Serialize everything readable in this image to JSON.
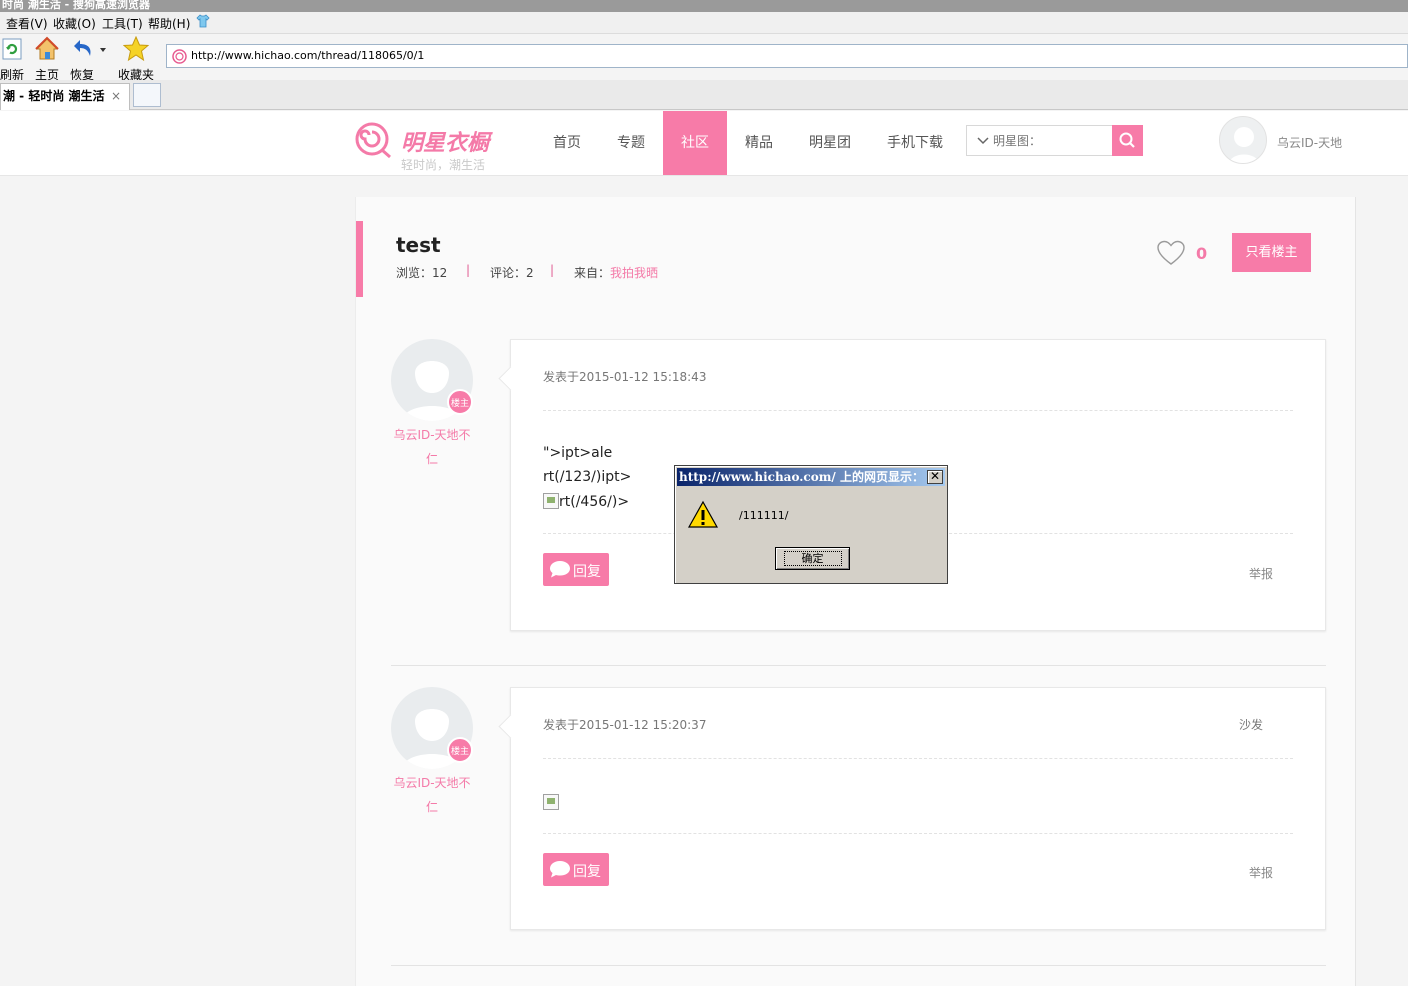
{
  "browser": {
    "window_title": "时尚 潮生活 - 搜狗高速浏览器",
    "menu": [
      "查看(V)",
      "收藏(O)",
      "工具(T)",
      "帮助(H)"
    ],
    "toolbar": {
      "refresh": "刷新",
      "home": "主页",
      "restore": "恢复",
      "favorites": "收藏夹"
    },
    "address": "http://www.hichao.com/thread/118065/0/1",
    "tab_title": "潮 - 轻时尚 潮生活",
    "tab_close": "×"
  },
  "site": {
    "logo_name": "明星衣橱",
    "logo_slogan": "轻时尚，潮生活",
    "nav": [
      "首页",
      "专题",
      "社区",
      "精品",
      "明星团",
      "手机下载"
    ],
    "search_placeholder": "明星图：",
    "user_name": "乌云ID-天地"
  },
  "thread": {
    "title": "test",
    "views_label": "浏览：",
    "views": "12",
    "comments_label": "评论：",
    "comments": "2",
    "source_label": "来自：",
    "source": "我拍我晒",
    "separator": "|",
    "likes": "0",
    "only_op_label": "只看楼主"
  },
  "posts": [
    {
      "badge": "楼主",
      "author_line1": "乌云ID-天地不",
      "author_line2": "仁",
      "time": "发表于2015-01-12 15:18:43",
      "floor": "",
      "body_line1": "\">ipt>ale",
      "body_line2": "rt(/123/)ipt>",
      "body_line3": "rt(/456/)>",
      "reply_label": "回复",
      "report_label": "举报"
    },
    {
      "badge": "楼主",
      "author_line1": "乌云ID-天地不",
      "author_line2": "仁",
      "time": "发表于2015-01-12 15:20:37",
      "floor": "沙发",
      "reply_label": "回复",
      "report_label": "举报"
    }
  ],
  "dialog": {
    "title": "http://www.hichao.com/ 上的网页显示：",
    "close": "✕",
    "message": "/111111/",
    "ok_label": "确定"
  },
  "colors": {
    "accent": "#f77ba8",
    "dialog_title": "#0a246a"
  }
}
